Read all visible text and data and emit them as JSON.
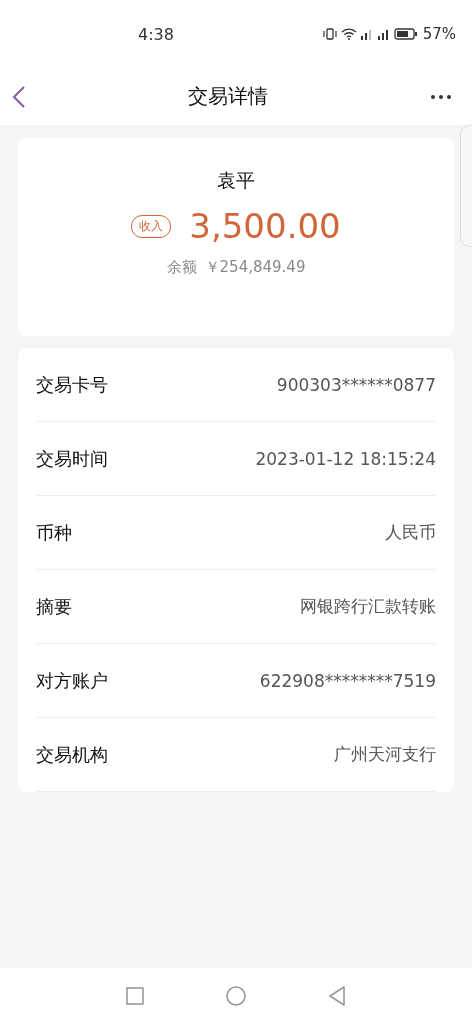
{
  "status_bar": {
    "time": "4:38",
    "battery": "57%"
  },
  "header": {
    "title": "交易详情"
  },
  "summary": {
    "name": "袁平",
    "tag": "收入",
    "amount": "3,500.00",
    "balance_label": "余额",
    "balance": "￥254,849.49"
  },
  "details": [
    {
      "label": "交易卡号",
      "value": "900303******0877"
    },
    {
      "label": "交易时间",
      "value": "2023-01-12 18:15:24"
    },
    {
      "label": "币种",
      "value": "人民币"
    },
    {
      "label": "摘要",
      "value": "网银跨行汇款转账"
    },
    {
      "label": "对方账户",
      "value": "622908********7519"
    },
    {
      "label": "交易机构",
      "value": "广州天河支行"
    }
  ]
}
